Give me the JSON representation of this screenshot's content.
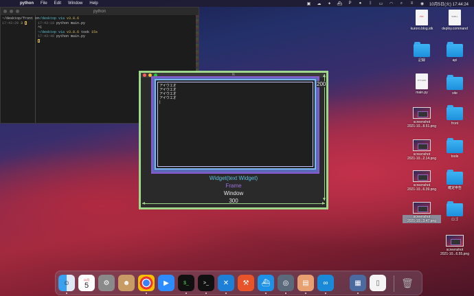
{
  "menubar": {
    "app_name": "python",
    "menus": [
      "File",
      "Edit",
      "Window",
      "Help"
    ],
    "clock": "10月5日(火) 17:44:24"
  },
  "terminal": {
    "title": "python",
    "left_pane": {
      "line1": "~/desktop/front on",
      "time1": "17:43:29",
      "prompt1": " 3 "
    },
    "right_pane": {
      "l1_path": "~/desktop via ",
      "l1_ver": "v3.8.6",
      "l2_time": "17:43:10",
      "l2_cmd": " python main.py",
      "l3": "^C",
      "l4_path": "~/desktop via ",
      "l4_ver": "v3.8.6",
      "l4_took": " took ",
      "l4_dur": "15s",
      "l5_time": "17:43:40",
      "l5_cmd": " python main.py"
    }
  },
  "tk_window": {
    "title": "tk",
    "text_lines": [
      "アイウエオ",
      "アイウエオ",
      "アイウエオ",
      "アイウエオ"
    ],
    "label_widget": "Widget(text Widget)",
    "label_frame": "Frame",
    "label_window": "Window",
    "width_label": "300",
    "height_label": "200",
    "colors": {
      "window_border": "#9fd88a",
      "frame": "#8a58d0",
      "widget": "#5ec0e0"
    }
  },
  "desktop_icons": [
    {
      "label": "kuroro.blog.stk",
      "icon": "pdf-doc-icon"
    },
    {
      "label": "deploy.command",
      "icon": "shell-doc-icon"
    },
    {
      "label": "記録",
      "icon": "folder-icon"
    },
    {
      "label": "api",
      "icon": "folder-icon"
    },
    {
      "label": "main.py",
      "icon": "python-doc-icon"
    },
    {
      "label": "site",
      "icon": "folder-icon"
    },
    {
      "label": "screenshot\n2021-10...8.51.png",
      "icon": "screenshot-icon"
    },
    {
      "label": "front",
      "icon": "folder-icon"
    },
    {
      "label": "screenshot\n2021-10...2.14.png",
      "icon": "screenshot-icon"
    },
    {
      "label": "tools",
      "icon": "folder-icon"
    },
    {
      "label": "screenshot\n2021-10...6.39.png",
      "icon": "screenshot-icon"
    },
    {
      "label": "確定申告",
      "icon": "folder-icon"
    },
    {
      "label": "screenshot\n2021-10...3.47.png",
      "icon": "screenshot-icon"
    },
    {
      "label": "ロゴ",
      "icon": "folder-icon"
    },
    {
      "label": "screenshot\n2021-10...6.55.png",
      "icon": "screenshot-icon"
    }
  ],
  "dock": {
    "calendar_month": "10月",
    "calendar_day": "5",
    "apps": [
      "finder",
      "calendar",
      "system-preferences",
      "contacts",
      "chrome",
      "zoom",
      "terminal-1",
      "terminal-2",
      "vscode",
      "instruments",
      "docker",
      "quicktime",
      "preview",
      "arduino",
      "photos",
      "document",
      "trash"
    ]
  }
}
